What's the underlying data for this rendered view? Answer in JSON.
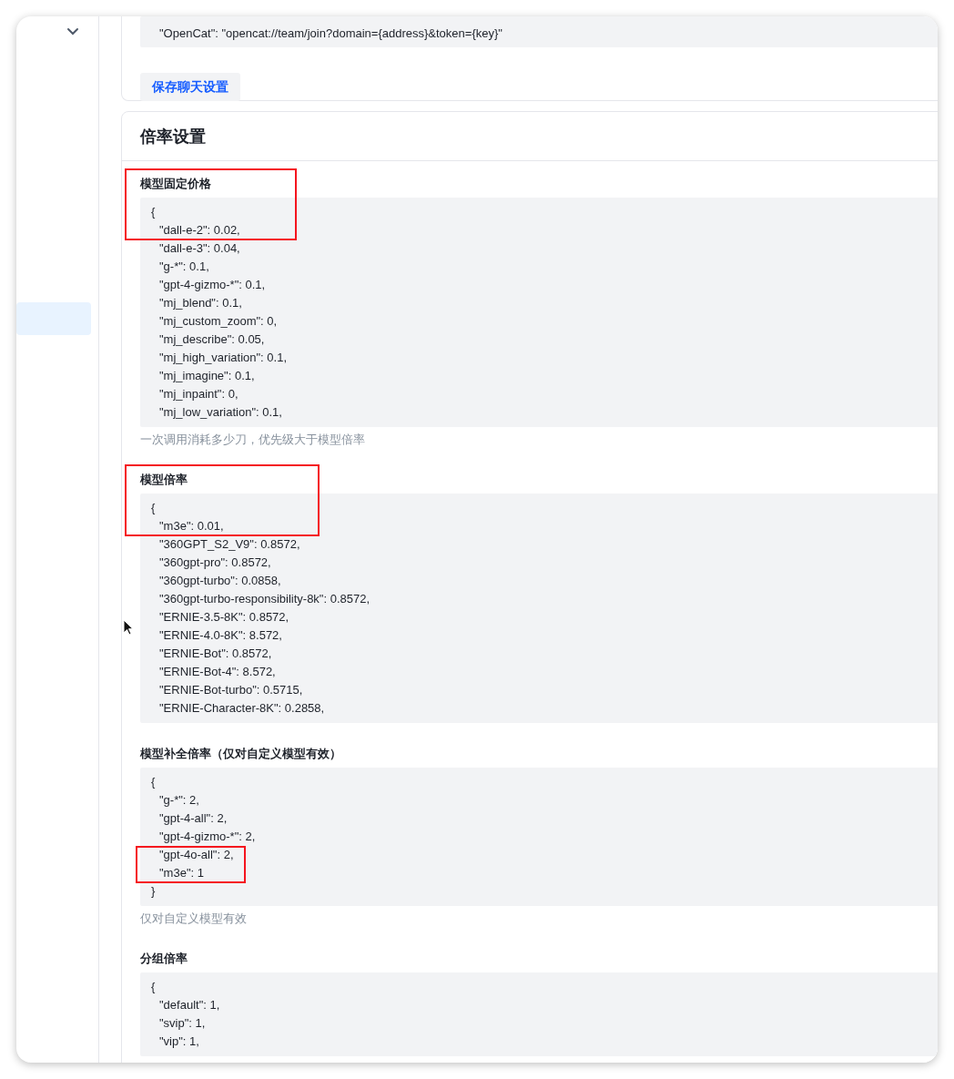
{
  "sidebar": {
    "items": [
      {
        "selected": true
      }
    ]
  },
  "chat_settings": {
    "lines": [
      {
        "kind": "entry",
        "text": "\"OpenCat\": \"opencat://team/join?domain={address}&token={key}\""
      }
    ],
    "save_button": "保存聊天设置"
  },
  "ratio_settings": {
    "title": "倍率设置",
    "fields": [
      {
        "label": "模型固定价格",
        "label_highlighted": true,
        "lines": [
          {
            "kind": "brace",
            "text": "{",
            "highlighted": true
          },
          {
            "kind": "entry",
            "text": "\"dall-e-2\": 0.02,",
            "highlighted": true
          },
          {
            "kind": "entry",
            "text": "\"dall-e-3\": 0.04,",
            "highlighted": false
          },
          {
            "kind": "entry",
            "text": "\"g-*\": 0.1,",
            "highlighted": false
          },
          {
            "kind": "entry",
            "text": "\"gpt-4-gizmo-*\": 0.1,",
            "highlighted": false
          },
          {
            "kind": "entry",
            "text": "\"mj_blend\": 0.1,",
            "highlighted": false
          },
          {
            "kind": "entry",
            "text": "\"mj_custom_zoom\": 0,",
            "highlighted": false
          },
          {
            "kind": "entry",
            "text": "\"mj_describe\": 0.05,",
            "highlighted": false
          },
          {
            "kind": "entry",
            "text": "\"mj_high_variation\": 0.1,",
            "highlighted": false
          },
          {
            "kind": "entry",
            "text": "\"mj_imagine\": 0.1,",
            "highlighted": false
          },
          {
            "kind": "entry",
            "text": "\"mj_inpaint\": 0,",
            "highlighted": false
          },
          {
            "kind": "entry",
            "text": "\"mj_low_variation\": 0.1,",
            "highlighted": false
          }
        ],
        "help": "一次调用消耗多少刀，优先级大于模型倍率"
      },
      {
        "label": "模型倍率",
        "label_highlighted": true,
        "lines": [
          {
            "kind": "brace",
            "text": "{",
            "highlighted": true
          },
          {
            "kind": "entry",
            "text": "\"m3e\": 0.01,",
            "highlighted": true
          },
          {
            "kind": "entry",
            "text": "\"360GPT_S2_V9\": 0.8572,",
            "highlighted": false
          },
          {
            "kind": "entry",
            "text": "\"360gpt-pro\": 0.8572,",
            "highlighted": false
          },
          {
            "kind": "entry",
            "text": "\"360gpt-turbo\": 0.0858,",
            "highlighted": false
          },
          {
            "kind": "entry",
            "text": "\"360gpt-turbo-responsibility-8k\": 0.8572,",
            "highlighted": false
          },
          {
            "kind": "entry",
            "text": "\"ERNIE-3.5-8K\": 0.8572,",
            "highlighted": false
          },
          {
            "kind": "entry",
            "text": "\"ERNIE-4.0-8K\": 8.572,",
            "highlighted": false
          },
          {
            "kind": "entry",
            "text": "\"ERNIE-Bot\": 0.8572,",
            "highlighted": false
          },
          {
            "kind": "entry",
            "text": "\"ERNIE-Bot-4\": 8.572,",
            "highlighted": false
          },
          {
            "kind": "entry",
            "text": "\"ERNIE-Bot-turbo\": 0.5715,",
            "highlighted": false
          },
          {
            "kind": "entry",
            "text": "\"ERNIE-Character-8K\": 0.2858,",
            "highlighted": false
          }
        ]
      },
      {
        "label": "模型补全倍率（仅对自定义模型有效）",
        "label_highlighted": false,
        "lines": [
          {
            "kind": "brace",
            "text": "{",
            "highlighted": false
          },
          {
            "kind": "entry",
            "text": "\"g-*\": 2,",
            "highlighted": false
          },
          {
            "kind": "entry",
            "text": "\"gpt-4-all\": 2,",
            "highlighted": false
          },
          {
            "kind": "entry",
            "text": "\"gpt-4-gizmo-*\": 2,",
            "highlighted": false
          },
          {
            "kind": "entry",
            "text": "\"gpt-4o-all\": 2,",
            "highlighted": true
          },
          {
            "kind": "entry",
            "text": "\"m3e\": 1",
            "highlighted": true
          },
          {
            "kind": "brace",
            "text": "}",
            "highlighted": false
          }
        ],
        "help": "仅对自定义模型有效"
      },
      {
        "label": "分组倍率",
        "label_highlighted": false,
        "lines": [
          {
            "kind": "brace",
            "text": "{",
            "highlighted": false
          },
          {
            "kind": "entry",
            "text": "\"default\": 1,",
            "highlighted": false
          },
          {
            "kind": "entry",
            "text": "\"svip\": 1,",
            "highlighted": false
          },
          {
            "kind": "entry",
            "text": "\"vip\": 1,",
            "highlighted": false
          }
        ]
      }
    ]
  }
}
